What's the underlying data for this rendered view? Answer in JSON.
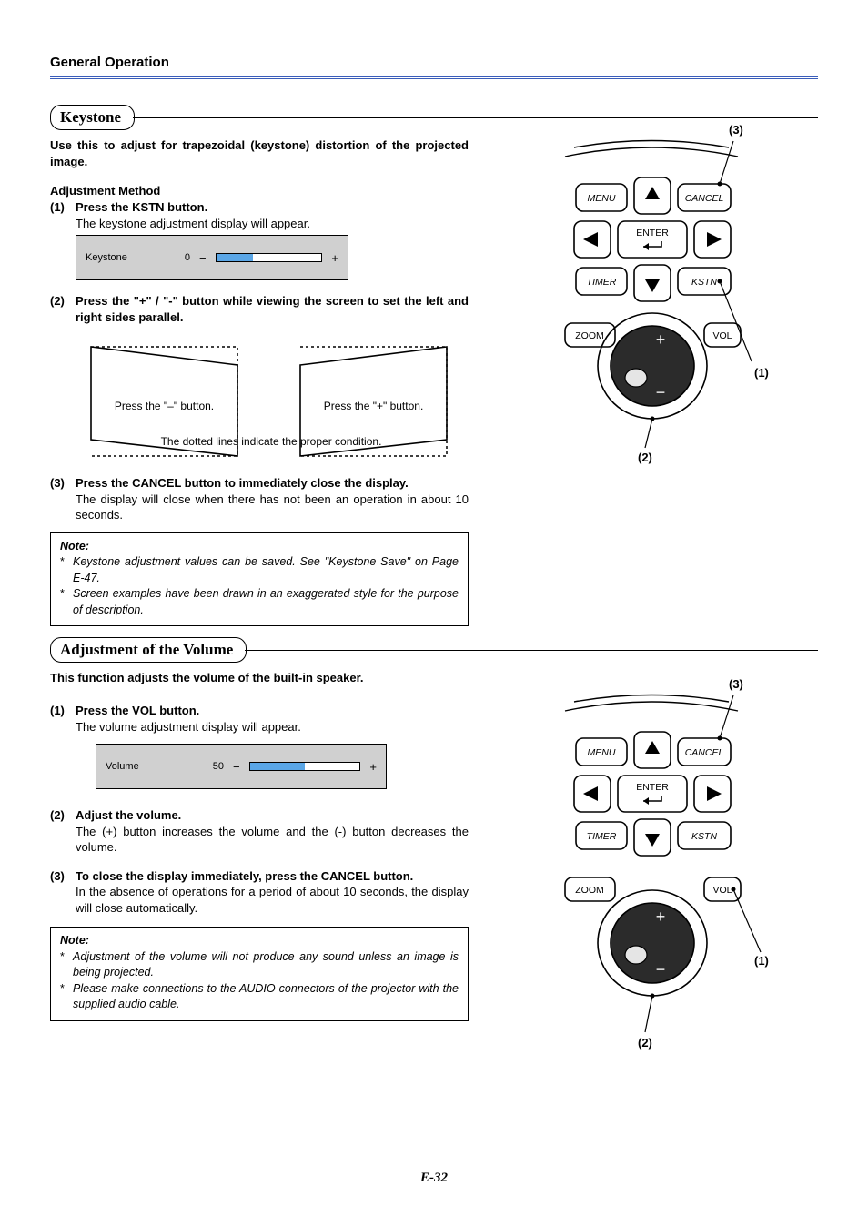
{
  "header": {
    "title": "General Operation"
  },
  "keystone": {
    "pill": "Keystone",
    "intro": "Use this to adjust for trapezoidal (keystone) distortion of the projected image.",
    "adj_method": "Adjustment Method",
    "step1_num": "(1)",
    "step1_bold": "Press the KSTN button.",
    "step1_text": "The keystone adjustment display will appear.",
    "osd": {
      "label": "Keystone",
      "value": "0",
      "minus": "−",
      "plus": "+"
    },
    "step2_num": "(2)",
    "step2_bold": "Press the \"+\" / \"-\" button while viewing the screen to set the left and right sides parallel.",
    "trap_minus": "Press the \"–\" button.",
    "trap_plus": "Press the \"+\" button.",
    "trap_caption": "The dotted lines indicate the proper condition.",
    "step3_num": "(3)",
    "step3_bold": "Press the CANCEL button to immediately close the display.",
    "step3_text": "The display will close when there has not been an operation in about 10 seconds.",
    "note_title": "Note:",
    "note1": "Keystone adjustment values can be saved. See \"Keystone Save\" on Page E-47.",
    "note2": "Screen examples have been drawn in an exaggerated style for the purpose of description.",
    "callout1": "(1)",
    "callout2": "(2)",
    "callout3": "(3)"
  },
  "volume": {
    "pill": "Adjustment of the Volume",
    "intro": "This function adjusts the volume of the built-in speaker.",
    "step1_num": "(1)",
    "step1_bold": "Press the VOL button.",
    "step1_text": "The volume adjustment display will appear.",
    "osd": {
      "label": "Volume",
      "value": "50",
      "minus": "−",
      "plus": "+"
    },
    "step2_num": "(2)",
    "step2_bold": "Adjust the volume.",
    "step2_text": "The (+) button increases the volume and the (-) button decreases the volume.",
    "step3_num": "(3)",
    "step3_bold": "To close the display immediately, press the CANCEL button.",
    "step3_text": "In the absence of operations for a period of about 10 seconds, the display will close automatically.",
    "note_title": "Note:",
    "note1": "Adjustment of the volume will not produce any sound unless an image is being projected.",
    "note2": "Please make connections to the AUDIO connectors of the projector with the supplied audio cable.",
    "callout1": "(1)",
    "callout2": "(2)",
    "callout3": "(3)"
  },
  "remote_labels": {
    "menu": "MENU",
    "cancel": "CANCEL",
    "enter": "ENTER",
    "timer": "TIMER",
    "kstn": "KSTN",
    "zoom": "ZOOM",
    "vol": "VOL"
  },
  "page_number": "E-32"
}
